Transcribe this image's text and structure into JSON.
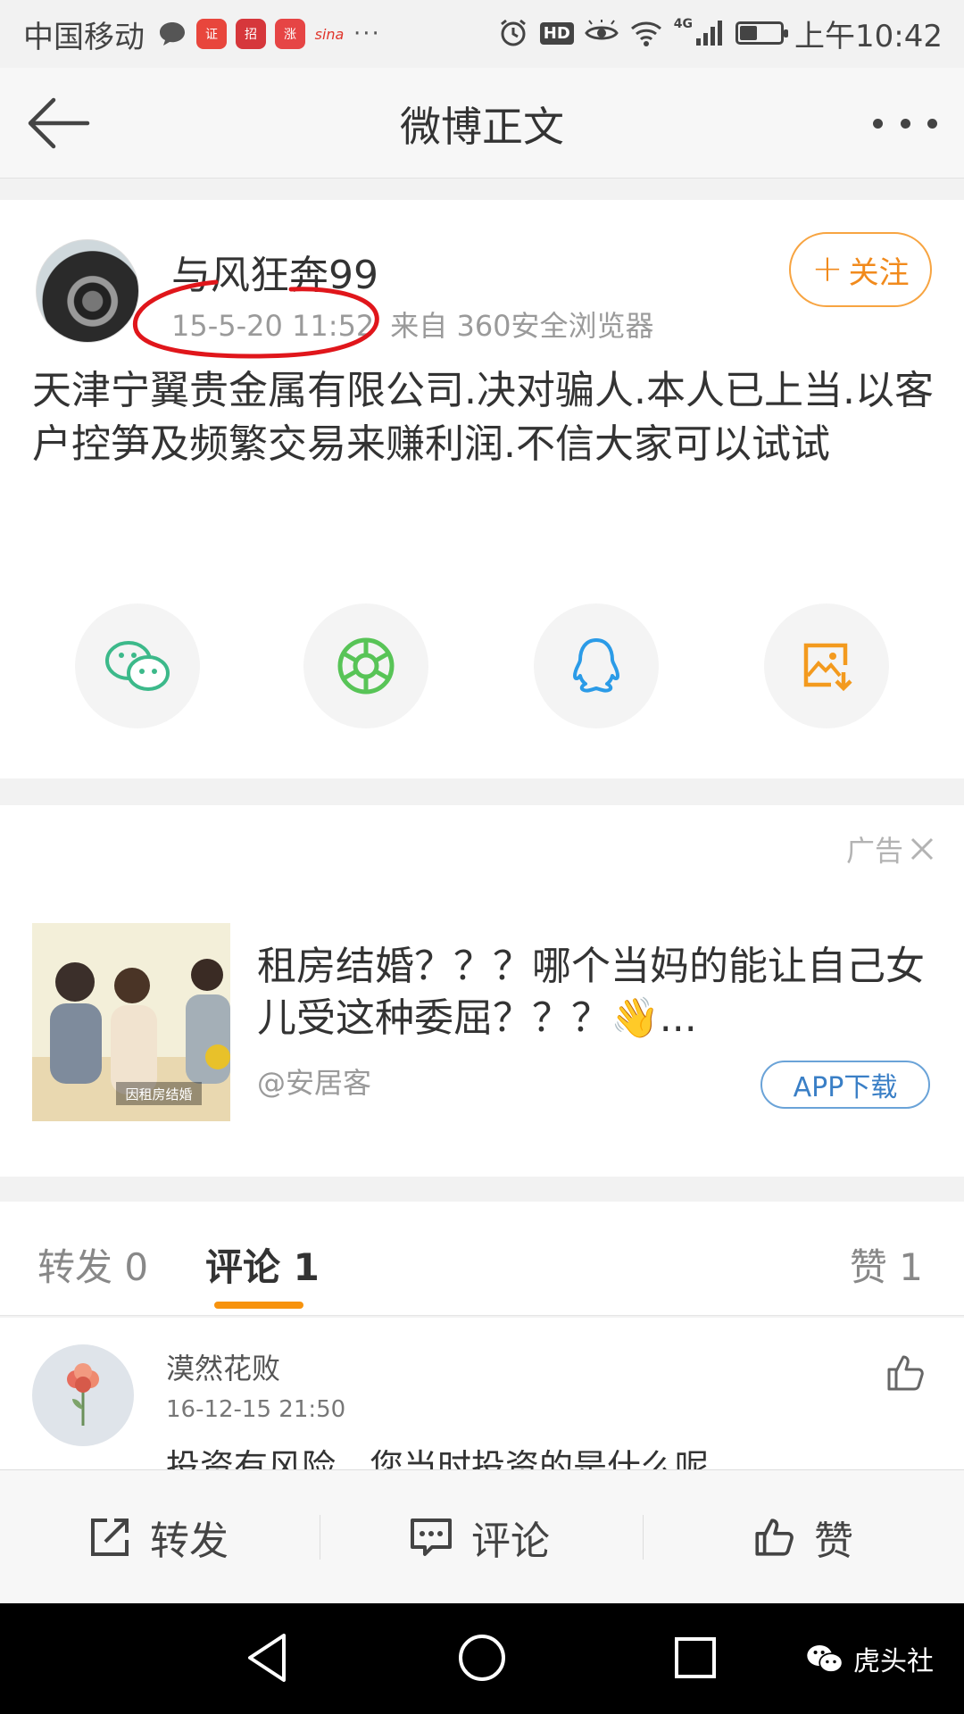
{
  "status_bar": {
    "carrier": "中国移动",
    "time": "上午10:42",
    "network": "4G",
    "hd": "HD",
    "apps": [
      {
        "label": "平安证券",
        "color": "#e8463c"
      },
      {
        "label": "招商",
        "color": "#d6373b"
      },
      {
        "label": "涨",
        "color": "#e64545"
      },
      {
        "label": "sina",
        "color": "#e0362c"
      }
    ],
    "battery_level": 0.4
  },
  "header": {
    "title": "微博正文"
  },
  "post": {
    "username": "与风狂奔99",
    "timestamp": "15-5-20 11:52",
    "source": "来自 360安全浏览器",
    "follow_label": "关注",
    "content": "天津宁翼贵金属有限公司.决对骗人.本人已上当.以客户控笋及频繁交易来赚利润.不信大家可以试试"
  },
  "ad": {
    "label": "广告",
    "title": "租房结婚？？？哪个当妈的能让自己女儿受这种委屈？？？👋...",
    "source": "@安居客",
    "button": "APP下载",
    "image_caption": "因租房结婚"
  },
  "tabs": {
    "repost": "转发 0",
    "comment": "评论 1",
    "like": "赞 1"
  },
  "comment": {
    "author": "漠然花败",
    "time": "16-12-15 21:50",
    "text": "投资有风险，您当时投资的是什么呢"
  },
  "actions": {
    "repost": "转发",
    "comment": "评论",
    "like": "赞"
  },
  "watermark": "虎头社",
  "colors": {
    "accent": "#f7930e",
    "follow": "#f18a1c",
    "link": "#3a7fc6",
    "mark": "#e0161b"
  }
}
